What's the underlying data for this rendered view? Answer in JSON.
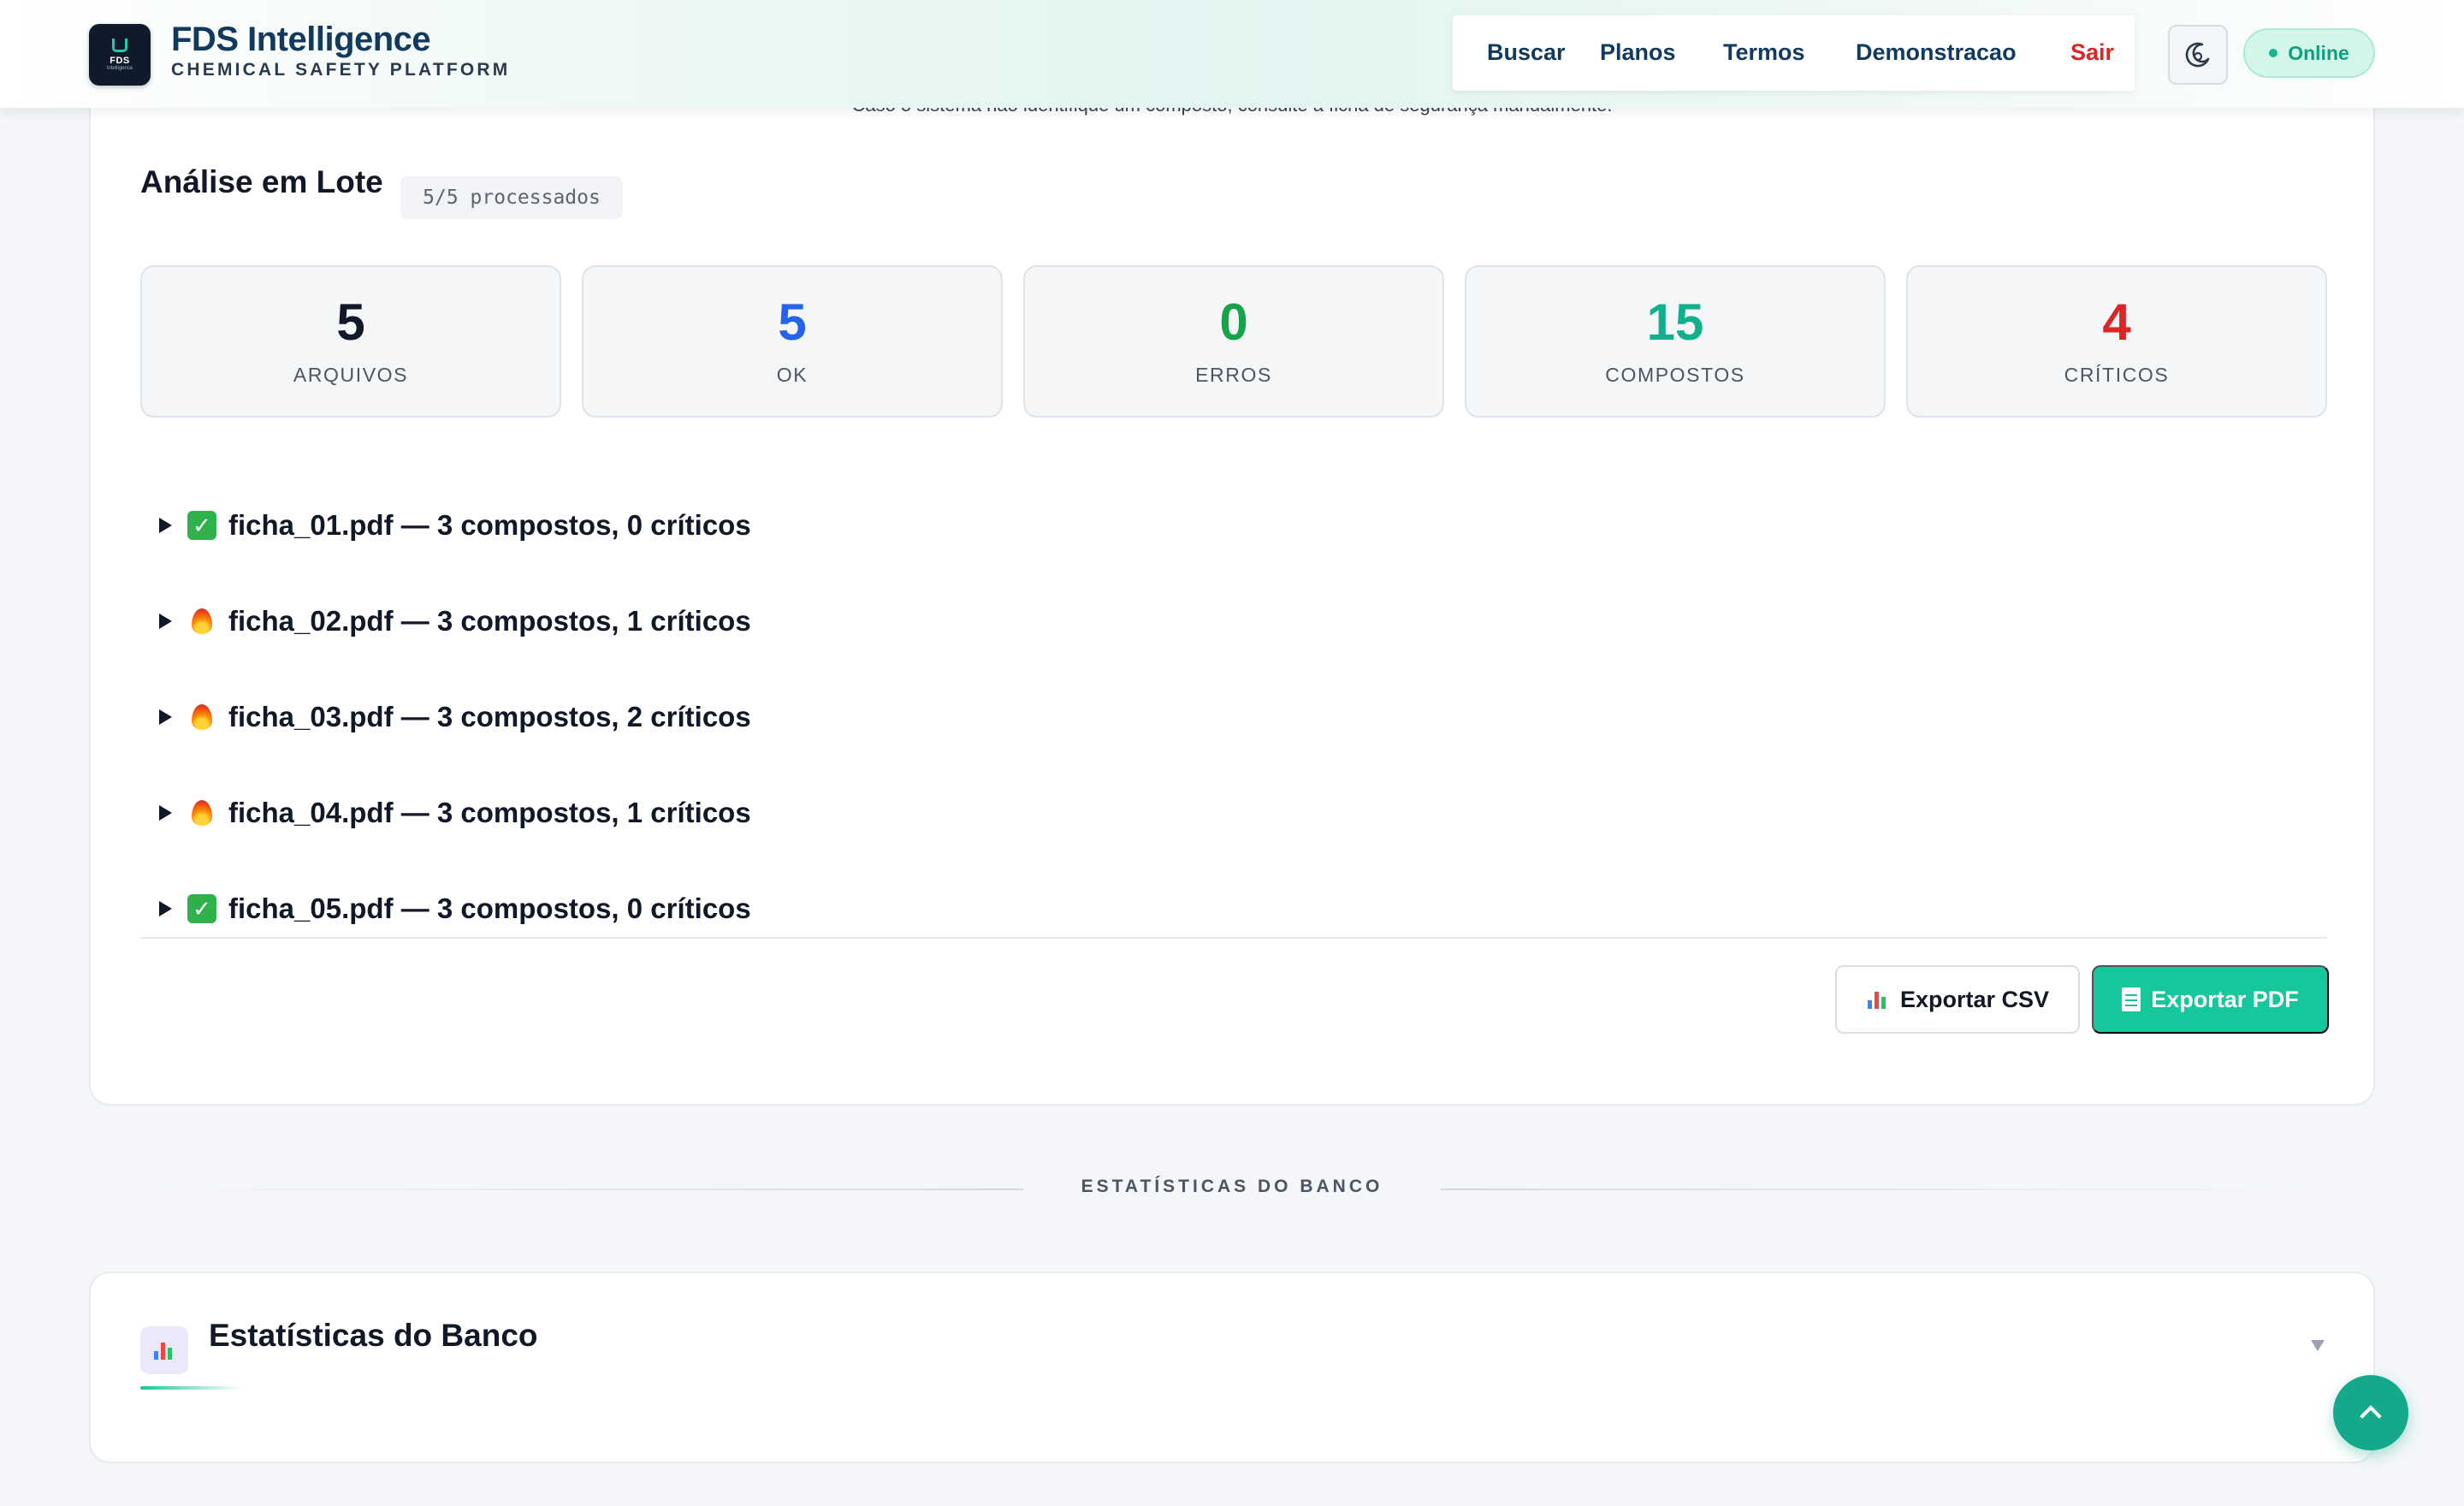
{
  "header": {
    "brand_title": "FDS Intelligence",
    "brand_subtitle": "CHEMICAL SAFETY PLATFORM",
    "logo_text": "FDS",
    "logo_subtext": "Intelligence",
    "nav": {
      "buscar": "Buscar",
      "planos": "Planos",
      "termos": "Termos",
      "demonstracao": "Demonstracao",
      "sair": "Sair"
    },
    "theme_toggle_icon": "moon-icon",
    "status": "Online"
  },
  "batch": {
    "notice": "Caso o sistema não identifique um composto, consulte a ficha de segurança manualmente.",
    "title": "Análise em Lote",
    "badge": "5/5 processados",
    "stats": [
      {
        "value": "5",
        "label": "ARQUIVOS",
        "color": "#111827"
      },
      {
        "value": "5",
        "label": "OK",
        "color": "#2563eb"
      },
      {
        "value": "0",
        "label": "ERROS",
        "color": "#16a34a"
      },
      {
        "value": "15",
        "label": "COMPOSTOS",
        "color": "#10b08c"
      },
      {
        "value": "4",
        "label": "CRÍTICOS",
        "color": "#dc2626"
      }
    ],
    "files": [
      {
        "icon": "check-icon",
        "text": "ficha_01.pdf — 3 compostos, 0 críticos"
      },
      {
        "icon": "fire-icon",
        "text": "ficha_02.pdf — 3 compostos, 1 críticos"
      },
      {
        "icon": "fire-icon",
        "text": "ficha_03.pdf — 3 compostos, 2 críticos"
      },
      {
        "icon": "fire-icon",
        "text": "ficha_04.pdf — 3 compostos, 1 críticos"
      },
      {
        "icon": "check-icon",
        "text": "ficha_05.pdf — 3 compostos, 0 críticos"
      }
    ],
    "export_csv": "Exportar CSV",
    "export_pdf": "Exportar PDF"
  },
  "section_label": "ESTATÍSTICAS DO BANCO",
  "db_stats": {
    "title": "Estatísticas do Banco",
    "icon": "bar-chart-icon"
  },
  "colors": {
    "brand": "#12395e",
    "accent": "#17c79c",
    "danger": "#dc2626"
  }
}
